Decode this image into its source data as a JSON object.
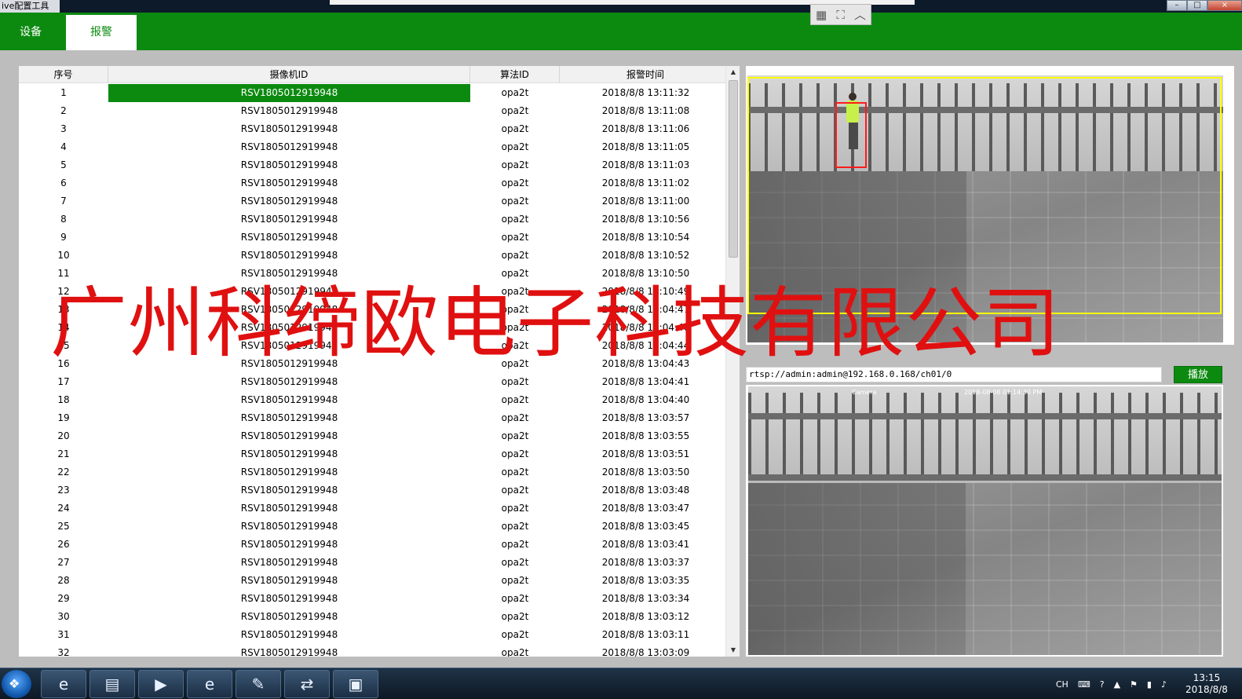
{
  "window": {
    "title": "ive配置工具",
    "controls": [
      "–",
      "□",
      "×"
    ]
  },
  "remote_toolbar": {
    "grid_icon": "grid-icon",
    "fullscreen_icon": "expand-icon",
    "collapse_icon": "chevron-up-icon"
  },
  "nav": {
    "tabs": [
      {
        "label": "设备"
      },
      {
        "label": "报警"
      }
    ],
    "active": "报警",
    "color": "#0c8a10"
  },
  "table": {
    "columns": [
      "序号",
      "摄像机ID",
      "算法ID",
      "报警时间"
    ],
    "selected_row": 1,
    "rows": [
      [
        "1",
        "RSV1805012919948",
        "opa2t",
        "2018/8/8 13:11:32"
      ],
      [
        "2",
        "RSV1805012919948",
        "opa2t",
        "2018/8/8 13:11:08"
      ],
      [
        "3",
        "RSV1805012919948",
        "opa2t",
        "2018/8/8 13:11:06"
      ],
      [
        "4",
        "RSV1805012919948",
        "opa2t",
        "2018/8/8 13:11:05"
      ],
      [
        "5",
        "RSV1805012919948",
        "opa2t",
        "2018/8/8 13:11:03"
      ],
      [
        "6",
        "RSV1805012919948",
        "opa2t",
        "2018/8/8 13:11:02"
      ],
      [
        "7",
        "RSV1805012919948",
        "opa2t",
        "2018/8/8 13:11:00"
      ],
      [
        "8",
        "RSV1805012919948",
        "opa2t",
        "2018/8/8 13:10:56"
      ],
      [
        "9",
        "RSV1805012919948",
        "opa2t",
        "2018/8/8 13:10:54"
      ],
      [
        "10",
        "RSV1805012919948",
        "opa2t",
        "2018/8/8 13:10:52"
      ],
      [
        "11",
        "RSV1805012919948",
        "opa2t",
        "2018/8/8 13:10:50"
      ],
      [
        "12",
        "RSV1805012919948",
        "opa2t",
        "2018/8/8 13:10:49"
      ],
      [
        "13",
        "RSV1805012919948",
        "opa2t",
        "2018/8/8 13:04:47"
      ],
      [
        "14",
        "RSV1805012919948",
        "opa2t",
        "2018/8/8 13:04:46"
      ],
      [
        "15",
        "RSV1805012919948",
        "opa2t",
        "2018/8/8 13:04:44"
      ],
      [
        "16",
        "RSV1805012919948",
        "opa2t",
        "2018/8/8 13:04:43"
      ],
      [
        "17",
        "RSV1805012919948",
        "opa2t",
        "2018/8/8 13:04:41"
      ],
      [
        "18",
        "RSV1805012919948",
        "opa2t",
        "2018/8/8 13:04:40"
      ],
      [
        "19",
        "RSV1805012919948",
        "opa2t",
        "2018/8/8 13:03:57"
      ],
      [
        "20",
        "RSV1805012919948",
        "opa2t",
        "2018/8/8 13:03:55"
      ],
      [
        "21",
        "RSV1805012919948",
        "opa2t",
        "2018/8/8 13:03:51"
      ],
      [
        "22",
        "RSV1805012919948",
        "opa2t",
        "2018/8/8 13:03:50"
      ],
      [
        "23",
        "RSV1805012919948",
        "opa2t",
        "2018/8/8 13:03:48"
      ],
      [
        "24",
        "RSV1805012919948",
        "opa2t",
        "2018/8/8 13:03:47"
      ],
      [
        "25",
        "RSV1805012919948",
        "opa2t",
        "2018/8/8 13:03:45"
      ],
      [
        "26",
        "RSV1805012919948",
        "opa2t",
        "2018/8/8 13:03:41"
      ],
      [
        "27",
        "RSV1805012919948",
        "opa2t",
        "2018/8/8 13:03:37"
      ],
      [
        "28",
        "RSV1805012919948",
        "opa2t",
        "2018/8/8 13:03:35"
      ],
      [
        "29",
        "RSV1805012919948",
        "opa2t",
        "2018/8/8 13:03:34"
      ],
      [
        "30",
        "RSV1805012919948",
        "opa2t",
        "2018/8/8 13:03:12"
      ],
      [
        "31",
        "RSV1805012919948",
        "opa2t",
        "2018/8/8 13:03:11"
      ],
      [
        "32",
        "RSV1805012919948",
        "opa2t",
        "2018/8/8 13:03:09"
      ]
    ]
  },
  "stream": {
    "url": "rtsp://admin:admin@192.168.0.168/ch01/0",
    "play_label": "播放"
  },
  "camera_overlay": {
    "left_text": "Camera",
    "timestamp": "2018-08-08 01:14:30 PM"
  },
  "watermark": "广州科缔欧电子科技有限公司",
  "taskbar": {
    "items": [
      "ie-icon",
      "folder-icon",
      "media-player-icon",
      "ie-icon",
      "notepad-icon",
      "teamviewer-icon",
      "app-window-icon"
    ],
    "tray": {
      "lang": "CH",
      "time": "13:15",
      "date": "2018/8/8"
    }
  },
  "colors": {
    "accent": "#0c8a10",
    "alert_box": "#ff1b1b",
    "zone_box": "#ffff00",
    "watermark": "#e01010"
  }
}
